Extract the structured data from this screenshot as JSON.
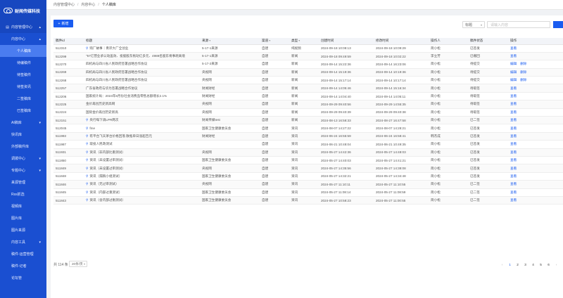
{
  "brand": {
    "name": "财闻传媒科技"
  },
  "sidebar": {
    "items": [
      {
        "label": "内容管理中心",
        "level": 1,
        "state": "parent-open",
        "chevron": "▴",
        "icon": "doc"
      },
      {
        "label": "内容中心",
        "level": 2,
        "state": "",
        "chevron": "▴"
      },
      {
        "label": "个人稿库",
        "level": 3,
        "state": "active"
      },
      {
        "label": "待编稿件",
        "level": 3,
        "state": ""
      },
      {
        "label": "待签稿件",
        "level": 3,
        "state": ""
      },
      {
        "label": "待签资讯",
        "level": 3,
        "state": ""
      },
      {
        "label": "二签稿库",
        "level": 3,
        "state": ""
      },
      {
        "label": "已签稿库",
        "level": 3,
        "state": ""
      },
      {
        "label": "AI稿库",
        "level": 2,
        "state": "",
        "chevron": "▾"
      },
      {
        "label": "快讯库",
        "level": 2,
        "state": ""
      },
      {
        "label": "外部稿件库",
        "level": 2,
        "state": ""
      },
      {
        "label": "调拨中心",
        "level": 2,
        "state": "",
        "chevron": "▾"
      },
      {
        "label": "专题中心",
        "level": 2,
        "state": "",
        "chevron": "▾"
      },
      {
        "label": "来源管理",
        "level": 2,
        "state": ""
      },
      {
        "label": "Rss抓选",
        "level": 2,
        "state": ""
      },
      {
        "label": "视频库",
        "level": 2,
        "state": ""
      },
      {
        "label": "图片库",
        "level": 2,
        "state": ""
      },
      {
        "label": "图片来源",
        "level": 2,
        "state": ""
      },
      {
        "label": "内容工具",
        "level": 2,
        "state": "",
        "chevron": "▾"
      },
      {
        "label": "稿件-运营管理",
        "level": 2,
        "state": ""
      },
      {
        "label": "稿件-记者",
        "level": 2,
        "state": ""
      },
      {
        "label": "论坛管",
        "level": 2,
        "state": ""
      }
    ]
  },
  "breadcrumb": {
    "items": [
      "内容管理中心",
      "内容中心",
      "个人稿库"
    ],
    "separator": "/"
  },
  "toolbar": {
    "add_label": "新增",
    "search_field": "标题",
    "search_placeholder": "请输入内容"
  },
  "table": {
    "columns": [
      "稿件id",
      "标题",
      "来源",
      "渠道",
      "类型",
      "创建时间",
      "修改时间",
      "操作人",
      "稿件状态",
      "操作"
    ],
    "rows": [
      {
        "id": "512310",
        "title": "购厂故事｜青岸大厂全创业",
        "link": true,
        "source": "5-17-1来源",
        "channel": "自建",
        "type": "纯视频",
        "created": "2024-09-18 10:08:13",
        "modified": "2024-09-18 10:09:29",
        "operator": "简小松",
        "status": "已签发",
        "ops": [
          "查看"
        ]
      },
      {
        "id": "512299",
        "title": "\"57亿营业承认动盖效、投股股东拖动亿多元、4988名股东将事耗离境",
        "link": false,
        "source": "5-17-1来源",
        "channel": "自建",
        "type": "新闻",
        "created": "2024-09-18 09:49:59",
        "modified": "2024-09-18 10:02:22",
        "operator": "李立芳",
        "status": "已撤回",
        "ops": [
          "查看"
        ]
      },
      {
        "id": "512270",
        "title": "四机局与四川省人民政府签署战略合作协议",
        "link": false,
        "source": "5-17-2来源",
        "channel": "自建",
        "type": "新闻",
        "created": "2024-09-14 15:22:36",
        "modified": "2024-09-14 16:23:06",
        "operator": "简小松",
        "status": "待提交",
        "ops": [
          "编辑",
          "删除"
        ]
      },
      {
        "id": "512269",
        "title": "四机局与四川省人民政府签署战略合作协议",
        "link": false,
        "source": "央视网",
        "channel": "自建",
        "type": "新闻",
        "created": "2024-09-14 15:19:36",
        "modified": "2024-09-14 10:19:36",
        "operator": "简小松",
        "status": "待提交",
        "ops": [
          "编辑",
          "删除"
        ]
      },
      {
        "id": "512268",
        "title": "四机局与四川省人民政府签署战略合作协议",
        "link": false,
        "source": "央视网",
        "channel": "自建",
        "type": "新闻",
        "created": "2024-09-14 15:17:14",
        "modified": "2024-09-14 10:17:14",
        "operator": "简小松",
        "status": "待提交",
        "ops": [
          "编辑",
          "删除"
        ]
      },
      {
        "id": "512257",
        "title": "广东省政府与华为签署战略合作协议",
        "link": false,
        "source": "财闻财经",
        "channel": "自建",
        "type": "新闻",
        "created": "2024-09-14 14:05:46",
        "modified": "2024-09-14 15:16:34",
        "operator": "简小松",
        "status": "待取签",
        "ops": [
          "查看"
        ]
      },
      {
        "id": "512206",
        "title": "国家统计局：2024年8月份社会消费品零售总额增长2.1%",
        "link": false,
        "source": "财闻财经",
        "channel": "自建",
        "type": "新闻",
        "created": "2024-09-14 14:04:40",
        "modified": "2024-09-14 14:05:11",
        "operator": "简小松",
        "status": "待取签",
        "ops": [
          "查看"
        ]
      },
      {
        "id": "512225",
        "title": "金价再创历史新高啊",
        "link": false,
        "source": "央视网",
        "channel": "自建",
        "type": "新闻",
        "created": "2024-09-29 09:40:56",
        "modified": "2024-09-29 14:55:35",
        "operator": "简小松",
        "status": "待取签",
        "ops": [
          "查看"
        ]
      },
      {
        "id": "512224",
        "title": "国际金价再创历史新高",
        "link": false,
        "source": "央视网",
        "channel": "自建",
        "type": "新闻",
        "created": "2024-09-29 09:40:39",
        "modified": "2024-09-29 09:40:38",
        "operator": "简小松",
        "status": "待取签",
        "ops": [
          "查看"
        ]
      },
      {
        "id": "512151",
        "title": "央行每下调LPR两次",
        "link": true,
        "source": "财闻传媒test",
        "channel": "自建",
        "type": "新闻",
        "created": "2024-08-13 16:58:33",
        "modified": "2024-08-27 16:47:58",
        "operator": "简小松",
        "status": "已二签",
        "ops": [
          "查看"
        ]
      },
      {
        "id": "512045",
        "title": "fme",
        "link": true,
        "source": "国家卫生健康委员会",
        "channel": "自建",
        "type": "资讯",
        "created": "2024-08-07 14:27:22",
        "modified": "2024-08-07 14:28:21",
        "operator": "简小松",
        "status": "已签发",
        "ops": [
          "查看"
        ]
      },
      {
        "id": "511993",
        "title": "有平台飞天茅台价格回落 散瓶单日涨超百元",
        "link": true,
        "source": "财闻财经",
        "channel": "自建",
        "type": "资讯",
        "created": "2024-06-24 16:55:59",
        "modified": "2024-06-24 16:58:41",
        "operator": "韩杰成",
        "status": "已签发",
        "ops": [
          "查看"
        ]
      },
      {
        "id": "511987",
        "title": "取投人民政测试",
        "link": true,
        "source": "",
        "channel": "自建",
        "type": "资讯",
        "created": "2024-06-21 10:48:04",
        "modified": "2024-06-21 10:49:35",
        "operator": "简小松",
        "status": "已签发",
        "ops": [
          "查看"
        ]
      },
      {
        "id": "511931",
        "title": "资讯（非内部比重测试）",
        "link": true,
        "source": "央视网",
        "channel": "自建",
        "type": "资讯",
        "created": "2024-05-27 14:42:36",
        "modified": "2024-05-27 14:48:03",
        "operator": "简小松",
        "status": "已签发",
        "ops": [
          "查看"
        ]
      },
      {
        "id": "511850",
        "title": "资讯（未设置过审测试）",
        "link": true,
        "source": "国家卫生健康委员会",
        "channel": "自建",
        "type": "资讯",
        "created": "2024-05-27 14:40:03",
        "modified": "2024-05-27 14:41:21",
        "operator": "简小松",
        "status": "已签发",
        "ops": [
          "查看"
        ]
      },
      {
        "id": "511849",
        "title": "资讯（未设置过审测试）",
        "link": true,
        "source": "央视网",
        "channel": "自建",
        "type": "资讯",
        "created": "2024-05-27 14:35:56",
        "modified": "2024-05-27 14:38:08",
        "operator": "简小松",
        "status": "已签发",
        "ops": [
          "查看"
        ]
      },
      {
        "id": "511848",
        "title": "资讯（漏稿小组测试）",
        "link": true,
        "source": "国家卫生健康委员会",
        "channel": "自建",
        "type": "资讯",
        "created": "2024-05-27 14:32:21",
        "modified": "2024-05-27 14:34:48",
        "operator": "简小松",
        "status": "已签发",
        "ops": [
          "查看"
        ]
      },
      {
        "id": "511846",
        "title": "资讯（无过审测试）",
        "link": true,
        "source": "央视网",
        "channel": "自建",
        "type": "资讯",
        "created": "2024-05-27 11:10:11",
        "modified": "2024-05-27 11:10:55",
        "operator": "简小松",
        "status": "已二签",
        "ops": [
          "查看"
        ]
      },
      {
        "id": "511845",
        "title": "资讯（内部过重测试）",
        "link": true,
        "source": "国家卫生健康委员会",
        "channel": "自建",
        "type": "资讯",
        "created": "2024-05-27 11:08:14",
        "modified": "2024-05-27 11:08:59",
        "operator": "简小松",
        "status": "已二签",
        "ops": [
          "查看"
        ]
      },
      {
        "id": "511843",
        "title": "资讯（含内部过衡测试）",
        "link": true,
        "source": "国家卫生健康委员会",
        "channel": "自建",
        "type": "资讯",
        "created": "2024-05-27 10:58:23",
        "modified": "2024-05-27 11:00:55",
        "operator": "简小松",
        "status": "已二签",
        "ops": [
          "查看"
        ]
      }
    ]
  },
  "footer": {
    "total": "共 114 条",
    "page_size": "20条/页",
    "pages": [
      "1",
      "2",
      "3",
      "4",
      "5",
      "6"
    ],
    "current_page": "1",
    "prev": "‹",
    "next": "›"
  },
  "colors": {
    "primary": "#1a5cf0",
    "sidebar": "#1a4fd1",
    "sidebar_active": "#4a7cf0"
  }
}
